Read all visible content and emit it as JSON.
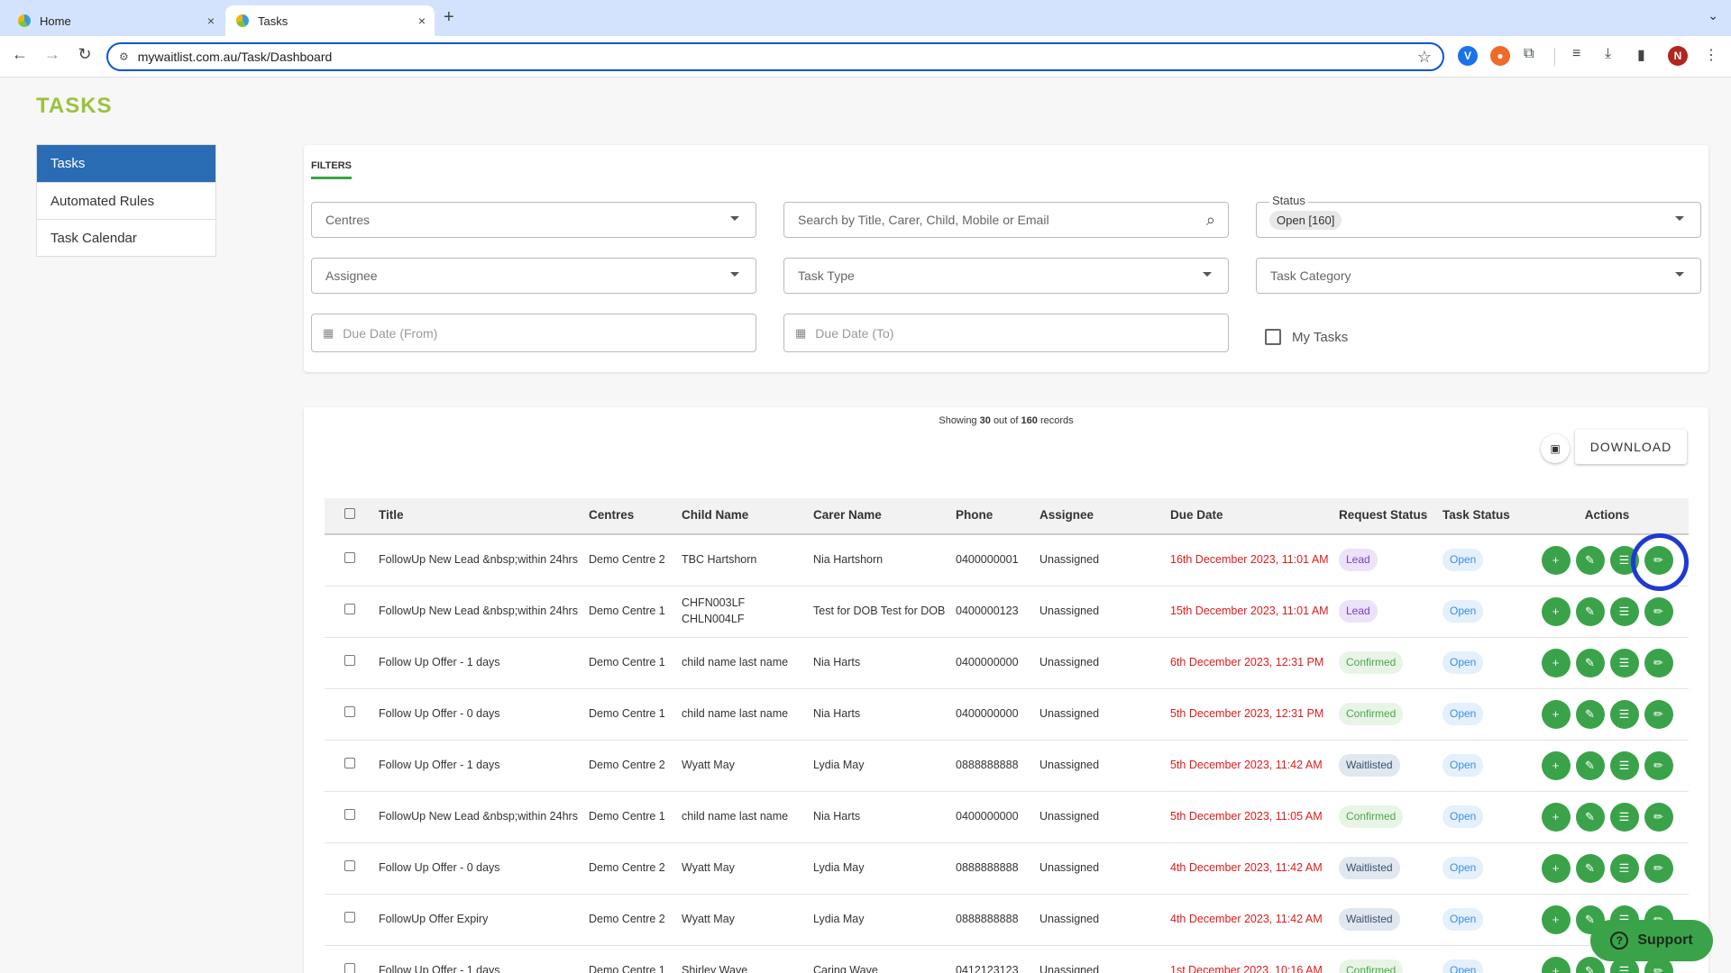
{
  "browser": {
    "tabs": [
      {
        "label": "Home",
        "close": "×"
      },
      {
        "label": "Tasks",
        "close": "×"
      }
    ],
    "new_tab": "+",
    "tab_menu": "⌄",
    "url": "mywaitlist.com.au/Task/Dashboard",
    "back": "←",
    "forward": "→",
    "reload": "↻",
    "tune_icon": "⚙",
    "star": "☆",
    "ext_v": "V",
    "ext_orange": "●",
    "puzzle": "⧉",
    "media": "≡",
    "download_ic": "⤓",
    "sidepanel": "▮",
    "profile": "N",
    "menu": "⋮"
  },
  "page": {
    "heading": "TASKS"
  },
  "sidenav": {
    "items": [
      "Tasks",
      "Automated Rules",
      "Task Calendar"
    ]
  },
  "filters": {
    "tab_label": "FILTERS",
    "centres_placeholder": "Centres",
    "search_placeholder": "Search by Title, Carer, Child, Mobile or Email",
    "status_label": "Status",
    "status_chip": "Open [160]",
    "assignee_placeholder": "Assignee",
    "task_type_placeholder": "Task Type",
    "task_category_placeholder": "Task Category",
    "due_from_placeholder": "Due Date (From)",
    "due_to_placeholder": "Due Date (To)",
    "my_tasks_label": "My Tasks"
  },
  "results": {
    "showing_prefix": "Showing",
    "shown": "30",
    "out_of": "out of",
    "total": "160",
    "records": "records",
    "download_label": "DOWNLOAD",
    "columns": [
      "Title",
      "Centres",
      "Child Name",
      "Carer Name",
      "Phone",
      "Assignee",
      "Due Date",
      "Request Status",
      "Task Status",
      "Actions"
    ],
    "rows": [
      {
        "title": "FollowUp New Lead &nbsp;within 24hrs",
        "centre": "Demo Centre 2",
        "child": "TBC Hartshorn",
        "carer": "Nia Hartshorn",
        "phone": "0400000001",
        "assignee": "Unassigned",
        "due": "16th December 2023, 11:01 AM",
        "request_status": "Lead",
        "task_status": "Open"
      },
      {
        "title": "FollowUp New Lead &nbsp;within 24hrs",
        "centre": "Demo Centre 1",
        "child": "CHFN003LF CHLN004LF",
        "carer": "Test for DOB Test for DOB",
        "phone": "0400000123",
        "assignee": "Unassigned",
        "due": "15th December 2023, 11:01 AM",
        "request_status": "Lead",
        "task_status": "Open"
      },
      {
        "title": "Follow Up Offer - 1 days",
        "centre": "Demo Centre 1",
        "child": "child name last name",
        "carer": "Nia Harts",
        "phone": "0400000000",
        "assignee": "Unassigned",
        "due": "6th December 2023, 12:31 PM",
        "request_status": "Confirmed",
        "task_status": "Open"
      },
      {
        "title": "Follow Up Offer - 0 days",
        "centre": "Demo Centre 1",
        "child": "child name last name",
        "carer": "Nia Harts",
        "phone": "0400000000",
        "assignee": "Unassigned",
        "due": "5th December 2023, 12:31 PM",
        "request_status": "Confirmed",
        "task_status": "Open"
      },
      {
        "title": "Follow Up Offer - 1 days",
        "centre": "Demo Centre 2",
        "child": "Wyatt May",
        "carer": "Lydia May",
        "phone": "0888888888",
        "assignee": "Unassigned",
        "due": "5th December 2023, 11:42 AM",
        "request_status": "Waitlisted",
        "task_status": "Open"
      },
      {
        "title": "FollowUp New Lead &nbsp;within 24hrs",
        "centre": "Demo Centre 1",
        "child": "child name last name",
        "carer": "Nia Harts",
        "phone": "0400000000",
        "assignee": "Unassigned",
        "due": "5th December 2023, 11:05 AM",
        "request_status": "Confirmed",
        "task_status": "Open"
      },
      {
        "title": "Follow Up Offer - 0 days",
        "centre": "Demo Centre 2",
        "child": "Wyatt May",
        "carer": "Lydia May",
        "phone": "0888888888",
        "assignee": "Unassigned",
        "due": "4th December 2023, 11:42 AM",
        "request_status": "Waitlisted",
        "task_status": "Open"
      },
      {
        "title": "FollowUp Offer Expiry",
        "centre": "Demo Centre 2",
        "child": "Wyatt May",
        "carer": "Lydia May",
        "phone": "0888888888",
        "assignee": "Unassigned",
        "due": "4th December 2023, 11:42 AM",
        "request_status": "Waitlisted",
        "task_status": "Open"
      },
      {
        "title": "Follow Up Offer - 1 days",
        "centre": "Demo Centre 1",
        "child": "Shirley Wave",
        "carer": "Caring Wave",
        "phone": "0412123123",
        "assignee": "Unassigned",
        "due": "1st December 2023, 10:16 AM",
        "request_status": "Confirmed",
        "task_status": "Open"
      }
    ],
    "action_icons": [
      {
        "name": "add-icon",
        "glyph": "+"
      },
      {
        "name": "note-icon",
        "glyph": "✎"
      },
      {
        "name": "list-icon",
        "glyph": "☰"
      },
      {
        "name": "edit-icon",
        "glyph": "✏"
      }
    ]
  },
  "support": {
    "label": "Support",
    "icon": "?"
  },
  "colors": {
    "brand_green": "#9bc23c",
    "action_green": "#3aa34a",
    "active_nav": "#2a6cb3",
    "due_red": "#e01b1b",
    "highlight_ring": "#1f3ad1"
  }
}
